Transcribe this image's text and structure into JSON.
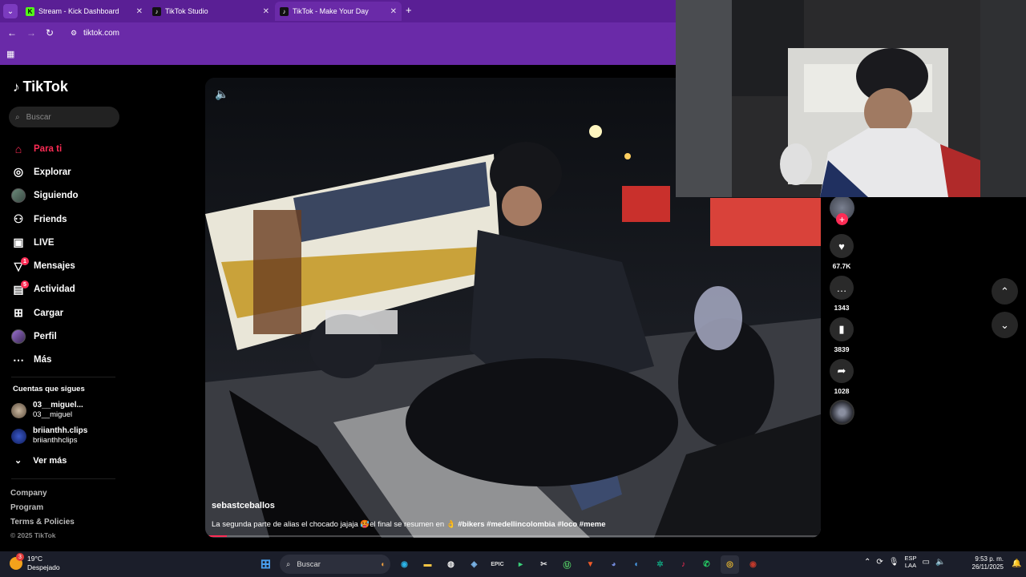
{
  "browser": {
    "tabs": [
      {
        "title": "Stream - Kick Dashboard",
        "favicon": "kick-icon",
        "color": "#53fc18"
      },
      {
        "title": "TikTok Studio",
        "favicon": "tiktok-icon",
        "color": "#000000"
      },
      {
        "title": "TikTok - Make Your Day",
        "favicon": "tiktok-icon",
        "color": "#000000"
      }
    ],
    "url": "tiktok.com",
    "accent": "#6a2aa8"
  },
  "sidebar": {
    "logo_text": "TikTok",
    "search_placeholder": "Buscar",
    "nav": [
      {
        "label": "Para ti",
        "icon": "home-icon",
        "active": true
      },
      {
        "label": "Explorar",
        "icon": "compass-icon"
      },
      {
        "label": "Siguiendo",
        "icon": "avatar-icon"
      },
      {
        "label": "Friends",
        "icon": "friends-icon"
      },
      {
        "label": "LIVE",
        "icon": "live-icon"
      },
      {
        "label": "Mensajes",
        "icon": "messages-icon",
        "badge": "1"
      },
      {
        "label": "Actividad",
        "icon": "activity-icon",
        "badge": "5"
      },
      {
        "label": "Cargar",
        "icon": "upload-icon"
      },
      {
        "label": "Perfil",
        "icon": "profile-avatar-icon"
      },
      {
        "label": "Más",
        "icon": "more-icon"
      }
    ],
    "following_title": "Cuentas que sigues",
    "following": [
      {
        "name": "03__miguel...",
        "handle": "03__miguel"
      },
      {
        "name": "briianthh.clips",
        "handle": "briianthhclips"
      }
    ],
    "see_more": "Ver más",
    "footer": [
      "Company",
      "Program",
      "Terms & Policies"
    ],
    "copyright": "© 2025 TikTok"
  },
  "video": {
    "author": "sebastceballos",
    "caption_text": "La segunda parte de alias el chocado jajaja 🥵el final se resumen en 👌",
    "hashtags": "#bikers #medellincolombia #loco #meme",
    "progress": 0.03
  },
  "actions": {
    "likes": "67.7K",
    "comments": "1343",
    "saves": "3839",
    "shares": "1028"
  },
  "taskbar": {
    "temperature": "19°C",
    "weather": "Despejado",
    "weather_badge": "3",
    "search_placeholder": "Buscar",
    "lang_top": "ESP",
    "lang_bottom": "LAA",
    "time": "9:53 p. m.",
    "date": "26/11/2025"
  }
}
